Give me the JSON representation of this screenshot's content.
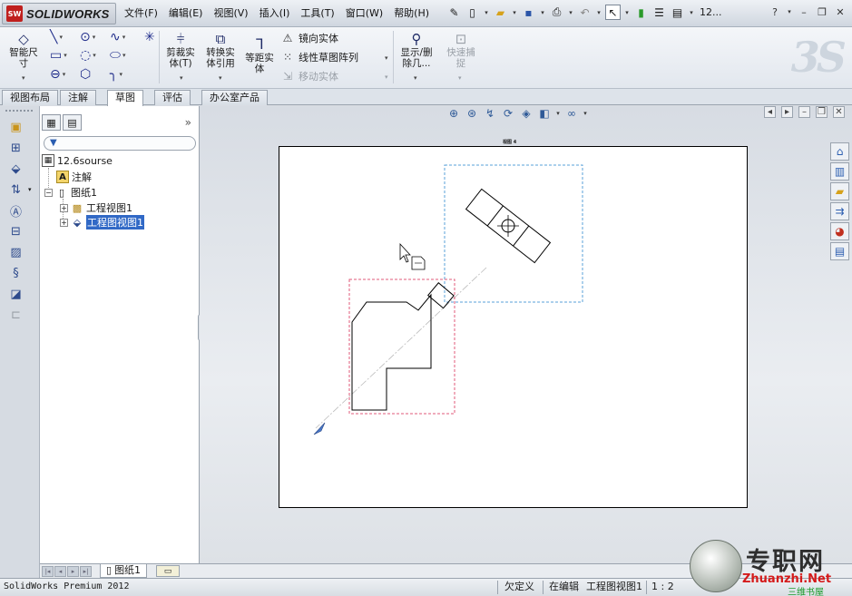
{
  "app": {
    "logo_text": "SOLIDWORKS",
    "logo_mark": "SW"
  },
  "menu": [
    "文件(F)",
    "编辑(E)",
    "视图(V)",
    "插入(I)",
    "工具(T)",
    "窗口(W)",
    "帮助(H)"
  ],
  "quick_access": {
    "field_value": "12..."
  },
  "ribbon": {
    "smart_dim": "智能尺寸",
    "trim": "剪裁实体(T)",
    "convert": "转换实体引用",
    "offset": "等距实体",
    "mirror": "镜向实体",
    "linear_pattern": "线性草图阵列",
    "move": "移动实体",
    "show_delete": "显示/删除几...",
    "quick_snap": "快速捕捉"
  },
  "tabs": [
    "视图布局",
    "注解",
    "草图",
    "评估",
    "办公室产品"
  ],
  "active_tab": "草图",
  "tree": {
    "root": "12.6sourse",
    "annotations": "注解",
    "sheet": "图纸1",
    "view1": "工程视图1",
    "view2": "工程图视图1"
  },
  "graphics": {
    "view_label": "视图 4"
  },
  "sheet_tab": "图纸1",
  "status": {
    "product": "SolidWorks Premium 2012",
    "state": "欠定义",
    "editing": "在编辑",
    "editing_target": "工程图视图1",
    "scale": "1 : 2"
  },
  "watermark": {
    "cn": "专职网",
    "en": "Zhuanzhi.Net",
    "sub": "三维书屋"
  },
  "colors": {
    "selection": "#3169c6",
    "view_box_blue": "#5aa0d8",
    "view_box_red": "#e05a7a",
    "brand_red": "#c0201e"
  }
}
